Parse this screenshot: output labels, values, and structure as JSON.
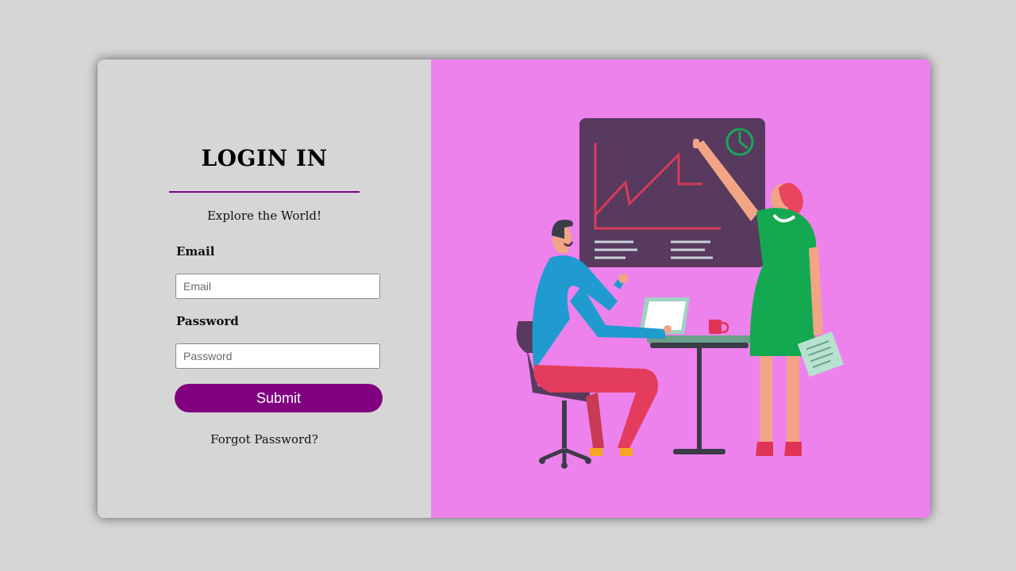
{
  "login": {
    "title": "LOGIN IN",
    "tagline": "Explore the World!",
    "email": {
      "label": "Email",
      "placeholder": "Email",
      "value": ""
    },
    "password": {
      "label": "Password",
      "placeholder": "Password",
      "value": ""
    },
    "submit_label": "Submit",
    "forgot_label": "Forgot Password?"
  },
  "colors": {
    "page_background": "#d6d6d6",
    "panel_background": "#d6d6d6",
    "accent": "#800080",
    "illustration_background": "#ed82ed"
  },
  "illustration": {
    "icon": "business-presentation-illustration"
  }
}
